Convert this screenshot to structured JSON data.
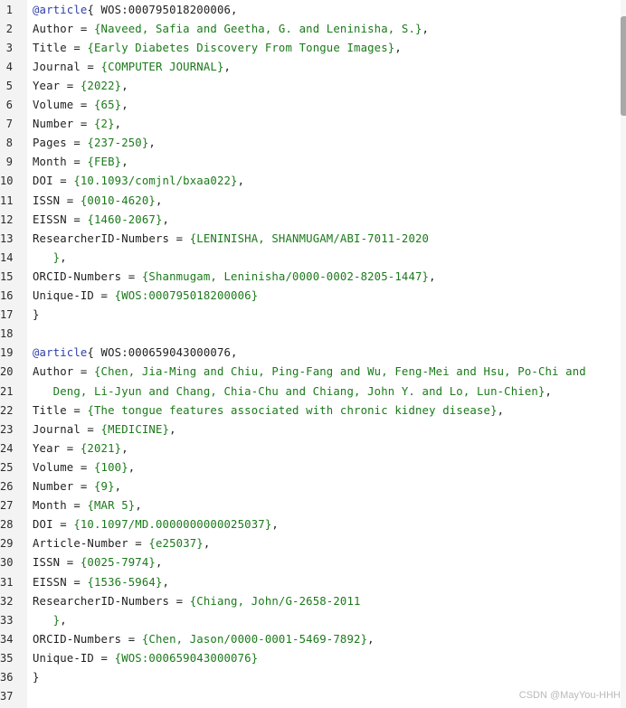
{
  "editor": {
    "lines": [
      {
        "n": "1",
        "t": [
          [
            "k",
            "@article"
          ],
          [
            "p",
            "{ WOS:000795018200006,"
          ]
        ]
      },
      {
        "n": "2",
        "t": [
          [
            "p",
            "Author = "
          ],
          [
            "v",
            "{Naveed, Safia and Geetha, G. and Leninisha, S.}"
          ],
          [
            "p",
            ","
          ]
        ]
      },
      {
        "n": "3",
        "t": [
          [
            "p",
            "Title = "
          ],
          [
            "v",
            "{Early Diabetes Discovery From Tongue Images}"
          ],
          [
            "p",
            ","
          ]
        ]
      },
      {
        "n": "4",
        "t": [
          [
            "p",
            "Journal = "
          ],
          [
            "v",
            "{COMPUTER JOURNAL}"
          ],
          [
            "p",
            ","
          ]
        ]
      },
      {
        "n": "5",
        "t": [
          [
            "p",
            "Year = "
          ],
          [
            "v",
            "{2022}"
          ],
          [
            "p",
            ","
          ]
        ]
      },
      {
        "n": "6",
        "t": [
          [
            "p",
            "Volume = "
          ],
          [
            "v",
            "{65}"
          ],
          [
            "p",
            ","
          ]
        ]
      },
      {
        "n": "7",
        "t": [
          [
            "p",
            "Number = "
          ],
          [
            "v",
            "{2}"
          ],
          [
            "p",
            ","
          ]
        ]
      },
      {
        "n": "8",
        "t": [
          [
            "p",
            "Pages = "
          ],
          [
            "v",
            "{237-250}"
          ],
          [
            "p",
            ","
          ]
        ]
      },
      {
        "n": "9",
        "t": [
          [
            "p",
            "Month = "
          ],
          [
            "v",
            "{FEB}"
          ],
          [
            "p",
            ","
          ]
        ]
      },
      {
        "n": "10",
        "t": [
          [
            "p",
            "DOI = "
          ],
          [
            "v",
            "{10.1093/comjnl/bxaa022}"
          ],
          [
            "p",
            ","
          ]
        ]
      },
      {
        "n": "11",
        "t": [
          [
            "p",
            "ISSN = "
          ],
          [
            "v",
            "{0010-4620}"
          ],
          [
            "p",
            ","
          ]
        ]
      },
      {
        "n": "12",
        "t": [
          [
            "p",
            "EISSN = "
          ],
          [
            "v",
            "{1460-2067}"
          ],
          [
            "p",
            ","
          ]
        ]
      },
      {
        "n": "13",
        "t": [
          [
            "p",
            "ResearcherID-Numbers = "
          ],
          [
            "v",
            "{LENINISHA, SHANMUGAM/ABI-7011-2020"
          ]
        ]
      },
      {
        "n": "14",
        "t": [
          [
            "v",
            "   }"
          ],
          [
            "p",
            ","
          ]
        ]
      },
      {
        "n": "15",
        "t": [
          [
            "p",
            "ORCID-Numbers = "
          ],
          [
            "v",
            "{Shanmugam, Leninisha/0000-0002-8205-1447}"
          ],
          [
            "p",
            ","
          ]
        ]
      },
      {
        "n": "16",
        "t": [
          [
            "p",
            "Unique-ID = "
          ],
          [
            "v",
            "{WOS:000795018200006}"
          ]
        ]
      },
      {
        "n": "17",
        "t": [
          [
            "p",
            "}"
          ]
        ]
      },
      {
        "n": "18",
        "t": []
      },
      {
        "n": "19",
        "t": [
          [
            "k",
            "@article"
          ],
          [
            "p",
            "{ WOS:000659043000076,"
          ]
        ]
      },
      {
        "n": "20",
        "t": [
          [
            "p",
            "Author = "
          ],
          [
            "v",
            "{Chen, Jia-Ming and Chiu, Ping-Fang and Wu, Feng-Mei and Hsu, Po-Chi and"
          ]
        ]
      },
      {
        "n": "21",
        "t": [
          [
            "v",
            "   Deng, Li-Jyun and Chang, Chia-Chu and Chiang, John Y. and Lo, Lun-Chien}"
          ],
          [
            "p",
            ","
          ]
        ]
      },
      {
        "n": "22",
        "t": [
          [
            "p",
            "Title = "
          ],
          [
            "v",
            "{The tongue features associated with chronic kidney disease}"
          ],
          [
            "p",
            ","
          ]
        ]
      },
      {
        "n": "23",
        "t": [
          [
            "p",
            "Journal = "
          ],
          [
            "v",
            "{MEDICINE}"
          ],
          [
            "p",
            ","
          ]
        ]
      },
      {
        "n": "24",
        "t": [
          [
            "p",
            "Year = "
          ],
          [
            "v",
            "{2021}"
          ],
          [
            "p",
            ","
          ]
        ]
      },
      {
        "n": "25",
        "t": [
          [
            "p",
            "Volume = "
          ],
          [
            "v",
            "{100}"
          ],
          [
            "p",
            ","
          ]
        ]
      },
      {
        "n": "26",
        "t": [
          [
            "p",
            "Number = "
          ],
          [
            "v",
            "{9}"
          ],
          [
            "p",
            ","
          ]
        ]
      },
      {
        "n": "27",
        "t": [
          [
            "p",
            "Month = "
          ],
          [
            "v",
            "{MAR 5}"
          ],
          [
            "p",
            ","
          ]
        ]
      },
      {
        "n": "28",
        "t": [
          [
            "p",
            "DOI = "
          ],
          [
            "v",
            "{10.1097/MD.0000000000025037}"
          ],
          [
            "p",
            ","
          ]
        ]
      },
      {
        "n": "29",
        "t": [
          [
            "p",
            "Article-Number = "
          ],
          [
            "v",
            "{e25037}"
          ],
          [
            "p",
            ","
          ]
        ]
      },
      {
        "n": "30",
        "t": [
          [
            "p",
            "ISSN = "
          ],
          [
            "v",
            "{0025-7974}"
          ],
          [
            "p",
            ","
          ]
        ]
      },
      {
        "n": "31",
        "t": [
          [
            "p",
            "EISSN = "
          ],
          [
            "v",
            "{1536-5964}"
          ],
          [
            "p",
            ","
          ]
        ]
      },
      {
        "n": "32",
        "t": [
          [
            "p",
            "ResearcherID-Numbers = "
          ],
          [
            "v",
            "{Chiang, John/G-2658-2011"
          ]
        ]
      },
      {
        "n": "33",
        "t": [
          [
            "v",
            "   }"
          ],
          [
            "p",
            ","
          ]
        ]
      },
      {
        "n": "34",
        "t": [
          [
            "p",
            "ORCID-Numbers = "
          ],
          [
            "v",
            "{Chen, Jason/0000-0001-5469-7892}"
          ],
          [
            "p",
            ","
          ]
        ]
      },
      {
        "n": "35",
        "t": [
          [
            "p",
            "Unique-ID = "
          ],
          [
            "v",
            "{WOS:000659043000076}"
          ]
        ]
      },
      {
        "n": "36",
        "t": [
          [
            "p",
            "}"
          ]
        ]
      },
      {
        "n": "37",
        "t": []
      }
    ]
  },
  "watermark": "CSDN @MayYou-HHH"
}
